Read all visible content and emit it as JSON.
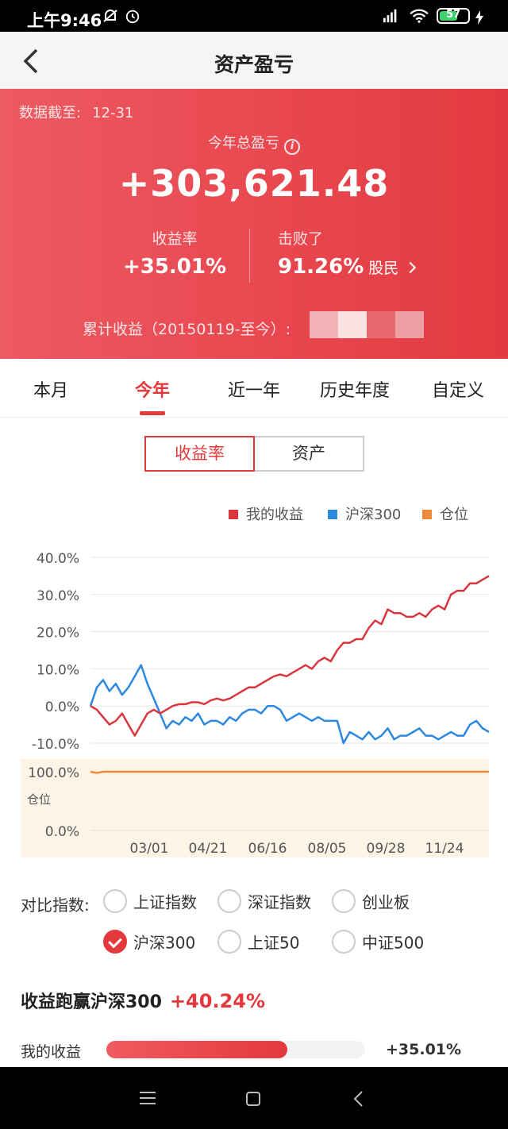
{
  "status_bar": {
    "time": "上午9:46",
    "battery": "57"
  },
  "nav": {
    "title": "资产盈亏"
  },
  "summary": {
    "date_label": "数据截至:",
    "date_value": "12-31",
    "year_label": "今年总盈亏",
    "total": "+303,621.48",
    "return_label": "收益率",
    "return_value": "+35.01%",
    "beat_label": "击败了",
    "beat_value": "91.26%",
    "beat_suffix": "股民",
    "cumulative_label": "累计收益（20150119-至今）:"
  },
  "tabs": [
    "本月",
    "今年",
    "近一年",
    "历史年度",
    "自定义"
  ],
  "active_tab": "今年",
  "toggle": {
    "left": "收益率",
    "right": "资产"
  },
  "legend": [
    {
      "label": "我的收益",
      "color": "#d9363e"
    },
    {
      "label": "沪深300",
      "color": "#2d88e0"
    },
    {
      "label": "仓位",
      "color": "#ef8a3a"
    }
  ],
  "chart_data": [
    {
      "type": "line",
      "x_ticks": [
        "03/01",
        "04/21",
        "06/16",
        "08/05",
        "09/28",
        "11/24"
      ],
      "y_ticks": [
        "40.0%",
        "30.0%",
        "20.0%",
        "10.0%",
        "0.0%",
        "-10.0%"
      ],
      "ylim": [
        -12,
        40
      ],
      "series": [
        {
          "name": "我的收益",
          "color": "#d9363e",
          "values": [
            0,
            -1,
            -3,
            -5,
            -4,
            -2,
            -5,
            -8,
            -5,
            -2,
            -1,
            -2,
            -1,
            0,
            0.5,
            0.5,
            1,
            1,
            0.5,
            1.5,
            2,
            1.5,
            2,
            3,
            4,
            5,
            5,
            6,
            7,
            8,
            8.5,
            8,
            9,
            10,
            11,
            10,
            12,
            13,
            12,
            15,
            17,
            17,
            18,
            18,
            21,
            23,
            22,
            26,
            25,
            25,
            24,
            24,
            25,
            24,
            26,
            27,
            26,
            30,
            31,
            31,
            33,
            33,
            34,
            35
          ]
        },
        {
          "name": "沪深300",
          "color": "#2d88e0",
          "values": [
            0,
            5,
            7,
            4,
            6,
            3,
            5,
            8,
            11,
            6,
            2,
            -2,
            -6,
            -4,
            -5,
            -3,
            -4,
            -2,
            -5,
            -4,
            -4,
            -5,
            -3,
            -4,
            -2,
            -1,
            -1,
            -2,
            0,
            0,
            -1,
            -4,
            -3,
            -2,
            -3,
            -4,
            -3,
            -4,
            -4,
            -4,
            -10,
            -7,
            -8,
            -9,
            -7,
            -9,
            -8,
            -6,
            -9,
            -8,
            -8,
            -7,
            -6,
            -8,
            -8,
            -9,
            -8,
            -7,
            -8,
            -8,
            -5,
            -4,
            -6,
            -7
          ]
        }
      ]
    },
    {
      "type": "line",
      "y_ticks": [
        "100.0%",
        "0.0%"
      ],
      "y_axis_label": "仓位",
      "ylim": [
        0,
        100
      ],
      "series": [
        {
          "name": "仓位",
          "color": "#ef8a3a",
          "values": [
            100,
            98,
            100,
            100,
            100,
            100,
            100,
            100,
            100,
            100,
            100,
            100,
            100,
            100,
            100,
            100,
            100,
            100,
            100,
            100,
            100,
            100,
            100,
            100,
            100,
            100,
            100,
            100,
            100,
            100,
            100,
            100,
            100,
            100,
            100,
            100,
            100,
            100,
            100,
            100,
            100,
            100,
            100,
            100,
            100,
            100,
            100,
            100,
            100,
            100,
            100,
            100,
            100,
            100,
            100,
            100,
            100,
            100,
            100,
            100,
            100,
            100,
            100,
            100
          ]
        }
      ]
    }
  ],
  "compare": {
    "label": "对比指数:",
    "options": [
      {
        "label": "上证指数",
        "checked": false
      },
      {
        "label": "深证指数",
        "checked": false
      },
      {
        "label": "创业板",
        "checked": false
      },
      {
        "label": "沪深300",
        "checked": true
      },
      {
        "label": "上证50",
        "checked": false
      },
      {
        "label": "中证500",
        "checked": false
      }
    ]
  },
  "outperform": {
    "label": "收益跑赢沪深300",
    "value": "+40.24%"
  },
  "my_return_bar": {
    "label": "我的收益",
    "value": "+35.01%",
    "fill_fraction": 0.7
  }
}
